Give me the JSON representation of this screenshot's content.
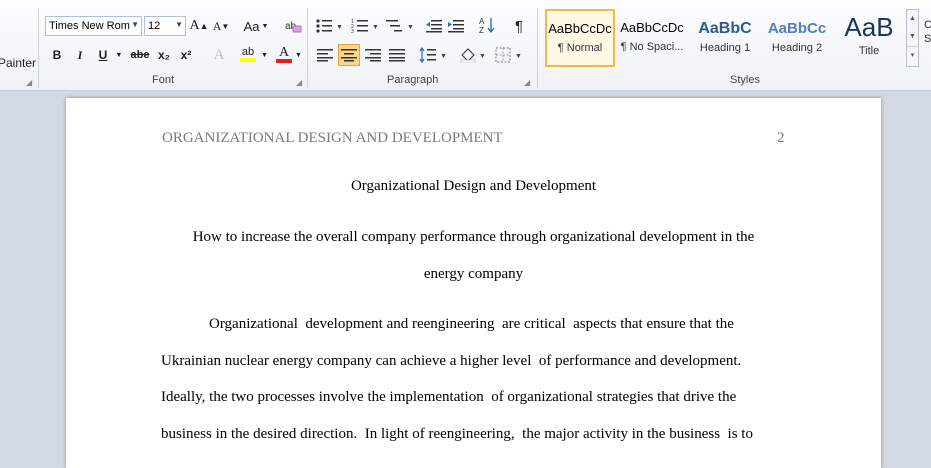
{
  "clipboard": {
    "painter_label": "Painter"
  },
  "font": {
    "group_label": "Font",
    "family": "Times New Rom",
    "size": "12",
    "grow_label": "A",
    "shrink_label": "A",
    "case_label": "Aa",
    "bold": "B",
    "italic": "I",
    "underline": "U",
    "strike": "abe",
    "subscript": "x₂",
    "superscript": "x²",
    "effects": "A",
    "highlight": "ab",
    "color": "A",
    "highlight_color": "#ffff00",
    "font_color": "#e02020"
  },
  "paragraph": {
    "group_label": "Paragraph",
    "pilcrow": "¶"
  },
  "styles": {
    "group_label": "Styles",
    "items": [
      {
        "sample": "AaBbCcDc",
        "name": "¶ Normal",
        "selected": true
      },
      {
        "sample": "AaBbCcDc",
        "name": "¶ No Spaci..."
      },
      {
        "sample": "AaBbC\u0000",
        "name": "Heading 1"
      },
      {
        "sample": "AaBbCc",
        "name": "Heading 2"
      },
      {
        "sample": "AaB",
        "name": "Title"
      }
    ],
    "right_labels": [
      "C",
      "S"
    ]
  },
  "document": {
    "running_head": "ORGANIZATIONAL DESIGN AND DEVELOPMENT",
    "page_number": "2",
    "title": "Organizational Design and Development",
    "subtitle_line1": "How to increase the overall company performance through organizational development in the",
    "subtitle_line2": "energy company",
    "body_lines": [
      "Organizational  development and reengineering  are critical  aspects that ensure that the",
      "Ukrainian nuclear energy company can achieve a higher level  of performance and development.",
      "Ideally, the two processes involve the implementation  of organizational strategies that drive the",
      "business in the desired direction.  In light of reengineering,  the major activity in the business  is to"
    ]
  }
}
